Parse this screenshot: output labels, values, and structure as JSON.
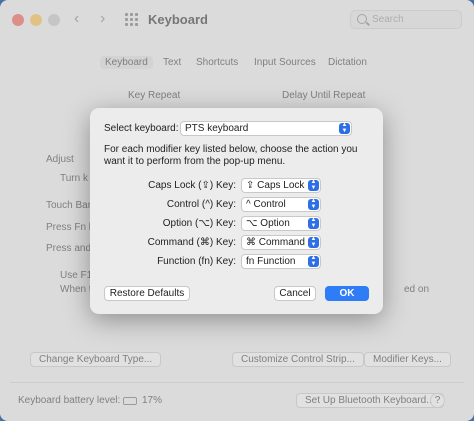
{
  "window": {
    "title": "Keyboard",
    "search_placeholder": "Search",
    "traffic_lights": {
      "close": "#ee5f57",
      "minimize": "#f5be4f",
      "zoom": "#c4c4c4"
    },
    "nav": {
      "back": "‹",
      "forward": "›"
    }
  },
  "tabs": [
    {
      "label": "Keyboard",
      "active": true
    },
    {
      "label": "Text",
      "active": false
    },
    {
      "label": "Shortcuts",
      "active": false
    },
    {
      "label": "Input Sources",
      "active": false
    },
    {
      "label": "Dictation",
      "active": false
    }
  ],
  "background": {
    "key_repeat": "Key Repeat",
    "delay_until_repeat": "Delay Until Repeat",
    "adjust": "Adjust",
    "turn": "Turn k",
    "touch_bar": "Touch Bar",
    "press_fn": "Press Fn k",
    "press_and": "Press and",
    "use_f": "Use F1,",
    "when_t": "When t",
    "ed_on": "ed on",
    "change_keyboard_type": "Change Keyboard Type...",
    "customize_control_strip": "Customize Control Strip...",
    "modifier_keys": "Modifier Keys...",
    "battery_label": "Keyboard battery level:",
    "battery_value": "17%",
    "bluetooth_button": "Set Up Bluetooth Keyboard...",
    "help": "?"
  },
  "dialog": {
    "select_keyboard_label": "Select keyboard:",
    "selected_keyboard": "PTS keyboard",
    "instructions": "For each modifier key listed below, choose the action you want it to perform from the pop-up menu.",
    "rows": [
      {
        "label": "Caps Lock (⇪) Key:",
        "value": "⇪ Caps Lock"
      },
      {
        "label": "Control (^) Key:",
        "value": "^ Control"
      },
      {
        "label": "Option (⌥) Key:",
        "value": "⌥ Option"
      },
      {
        "label": "Command (⌘) Key:",
        "value": "⌘ Command"
      },
      {
        "label": "Function (fn) Key:",
        "value": "fn Function"
      }
    ],
    "restore_defaults": "Restore Defaults",
    "cancel": "Cancel",
    "ok": "OK",
    "accent_color": "#2e7cf6"
  }
}
